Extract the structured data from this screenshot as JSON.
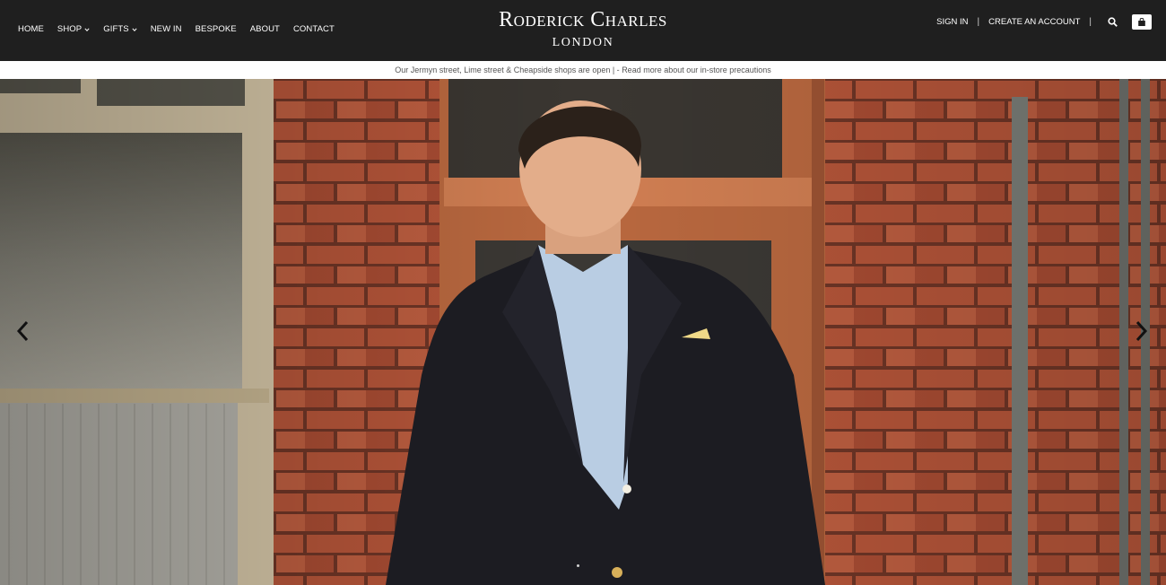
{
  "brand": {
    "name": "Roderick Charles",
    "city": "LONDON"
  },
  "nav": {
    "items": [
      {
        "label": "HOME",
        "has_dropdown": false
      },
      {
        "label": "SHOP",
        "has_dropdown": true
      },
      {
        "label": "GIFTS",
        "has_dropdown": true
      },
      {
        "label": "NEW IN",
        "has_dropdown": false
      },
      {
        "label": "BESPOKE",
        "has_dropdown": false
      },
      {
        "label": "ABOUT",
        "has_dropdown": false
      },
      {
        "label": "CONTACT",
        "has_dropdown": false
      }
    ]
  },
  "account": {
    "sign_in": "SIGN IN",
    "create_account": "CREATE AN ACCOUNT",
    "separator": "|",
    "icons": [
      "search-icon",
      "basket-icon"
    ]
  },
  "announcement": {
    "text": "Our Jermyn street, Lime street & Cheapside shops are open | - ",
    "link": "Read more about our in-store precautions"
  },
  "hero": {
    "controls": [
      "chevron-left-icon",
      "chevron-right-icon"
    ],
    "slide_count": 1
  },
  "colors": {
    "header_bg": "#1f1f1f",
    "header_text": "#ffffff",
    "announcement_bg": "#ffffff",
    "announcement_text": "#555555",
    "brick": "#b5533a",
    "suit": "#1c1c22"
  }
}
